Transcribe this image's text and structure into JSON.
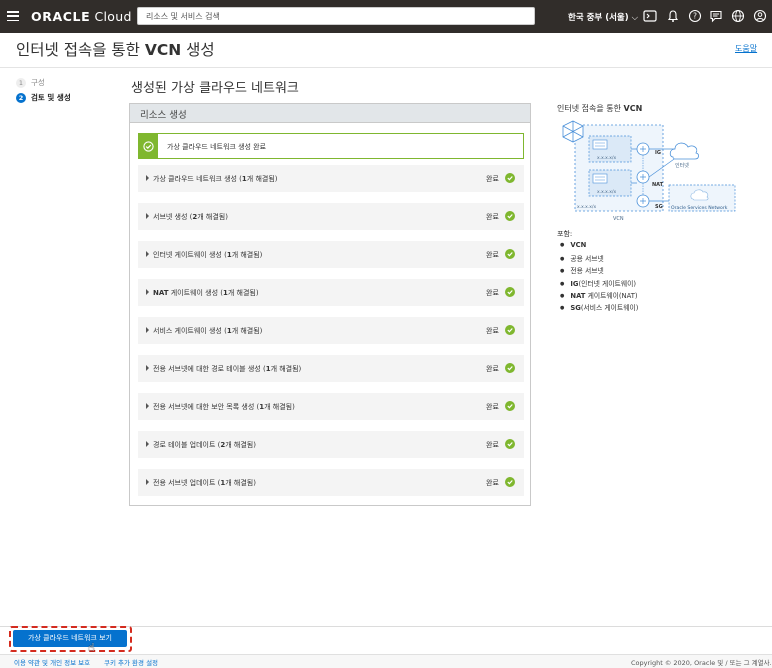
{
  "topbar": {
    "brand": "ORACLE",
    "brand_suffix": "Cloud",
    "search_placeholder": "리소스 및 서비스 검색",
    "region": "한국 중부 (서울)"
  },
  "header": {
    "title_prefix": "인터넷 접속을 통한",
    "title_bold": "VCN",
    "title_suffix": "생성",
    "help": "도움말"
  },
  "steps": [
    {
      "num": "1",
      "label": "구성"
    },
    {
      "num": "2",
      "label": "검토 및 생성"
    }
  ],
  "main": {
    "title": "생성된 가상 클라우드 네트워크",
    "panel_title": "리소스 생성",
    "banner": "가상 클라우드 네트워크 생성 완료",
    "rows": [
      {
        "pre": "가상 클라우드 네트워크 생성 (",
        "bold": "1",
        "post": "개 해결됨)",
        "status": "완료"
      },
      {
        "pre": "서브넷 생성 (",
        "bold": "2",
        "post": "개 해결됨)",
        "status": "완료"
      },
      {
        "pre": "인터넷 게이트웨이 생성 (",
        "bold": "1",
        "post": "개 해결됨)",
        "status": "완료"
      },
      {
        "pre": "",
        "bold0": "NAT",
        "pre2": " 게이트웨이 생성 (",
        "bold": "1",
        "post": "개 해결됨)",
        "status": "완료"
      },
      {
        "pre": "서비스 게이트웨이 생성 (",
        "bold": "1",
        "post": "개 해결됨)",
        "status": "완료"
      },
      {
        "pre": "전용 서브넷에 대한 경로 테이블 생성 (",
        "bold": "1",
        "post": "개 해결됨)",
        "status": "완료"
      },
      {
        "pre": "전용 서브넷에 대한 보안 목록 생성 (",
        "bold": "1",
        "post": "개 해결됨)",
        "status": "완료"
      },
      {
        "pre": "경로 테이블 업데이트 (",
        "bold": "2",
        "post": "개 해결됨)",
        "status": "완료"
      },
      {
        "pre": "전용 서브넷 업데이트 (",
        "bold": "1",
        "post": "개 해결됨)",
        "status": "완료"
      }
    ]
  },
  "side": {
    "title_prefix": "인터넷 접속을 통한",
    "title_bold": "VCN",
    "diagram": {
      "ig": "IG",
      "nat": "NAT",
      "sg": "SG",
      "internet": "인터넷",
      "vcn": "VCN",
      "osn": "Oracle Services Network",
      "cidr": "x.x.x.x/x"
    },
    "includes_label": "포함:",
    "includes": [
      {
        "bold": "VCN",
        "rest": ""
      },
      {
        "bold": "",
        "rest": "공용 서브넷"
      },
      {
        "bold": "",
        "rest": "전용 서브넷"
      },
      {
        "bold": "IG",
        "rest": "(인터넷 게이트웨이)"
      },
      {
        "bold": "NAT",
        "rest": " 게이트웨이(NAT)"
      },
      {
        "bold": "SG",
        "rest": "(서비스 게이트웨이)"
      }
    ]
  },
  "footer": {
    "button": "가상 클라우드 네트워크 보기",
    "link_terms": "이용 약관 및 개인 정보 보호",
    "link_cookies": "쿠키 추가 환경 설정",
    "copyright": "Copyright © 2020, Oracle 및 / 또는 그 계열사."
  },
  "colors": {
    "topbar": "#312d2a",
    "primary": "#0572ce",
    "success": "#7fb72f",
    "highlight": "#d42b1e"
  }
}
